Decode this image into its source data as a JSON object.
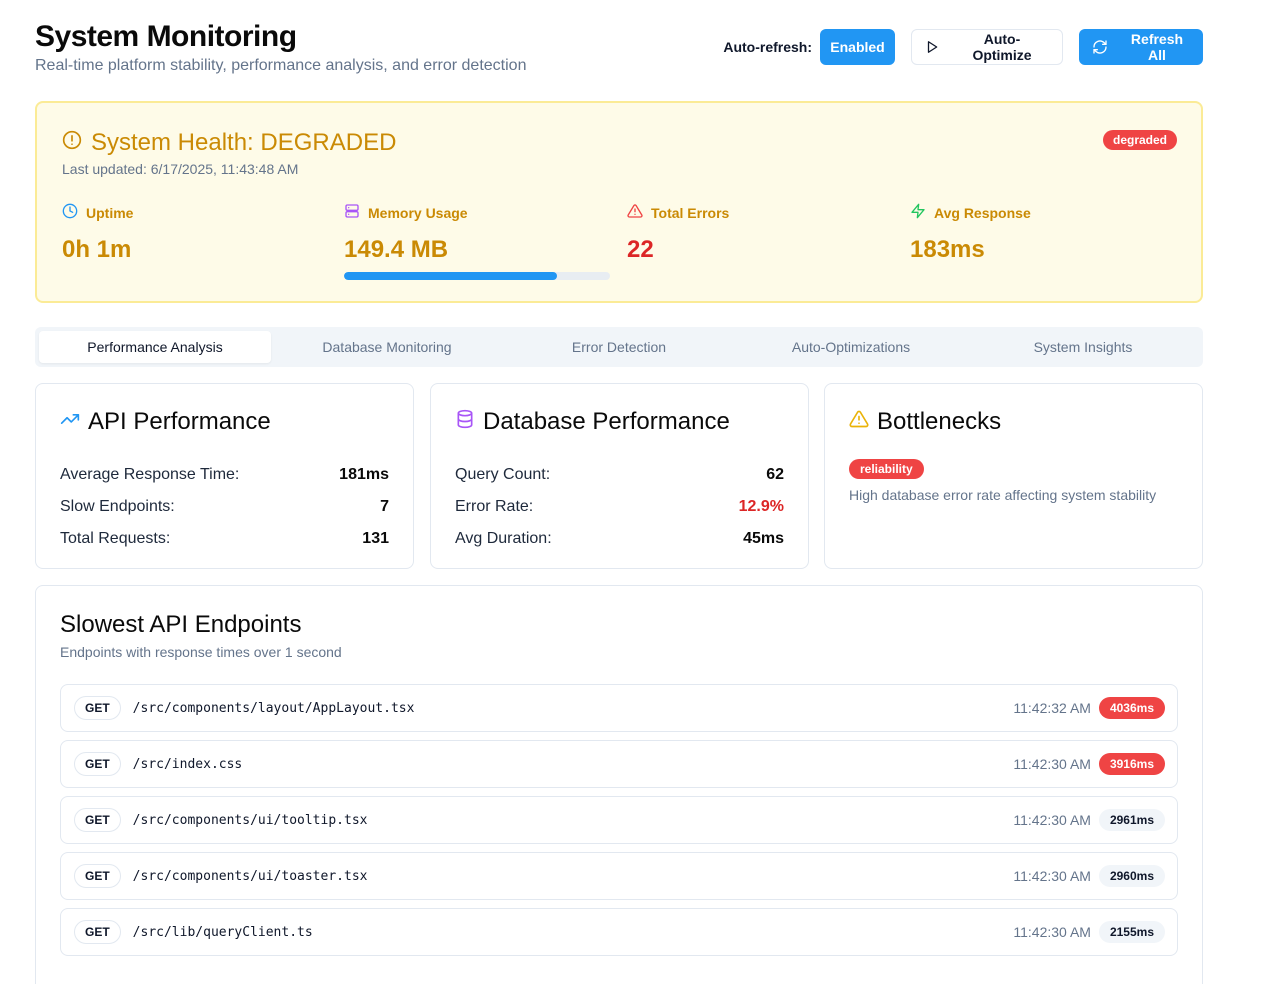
{
  "header": {
    "title": "System Monitoring",
    "subtitle": "Real-time platform stability, performance analysis, and error detection",
    "auto_refresh_label": "Auto-refresh:",
    "auto_refresh_state": "Enabled",
    "auto_optimize_label": "Auto-Optimize",
    "refresh_all_label": "Refresh All"
  },
  "health": {
    "title": "System Health: DEGRADED",
    "last_updated": "Last updated: 6/17/2025, 11:43:48 AM",
    "status_badge": "degraded",
    "metrics": {
      "uptime": {
        "label": "Uptime",
        "value": "0h 1m"
      },
      "memory": {
        "label": "Memory Usage",
        "value": "149.4 MB",
        "usage_fraction": 0.8
      },
      "errors": {
        "label": "Total Errors",
        "value": "22"
      },
      "response": {
        "label": "Avg Response",
        "value": "183ms"
      }
    }
  },
  "tabs": [
    {
      "label": "Performance Analysis",
      "active": true
    },
    {
      "label": "Database Monitoring",
      "active": false
    },
    {
      "label": "Error Detection",
      "active": false
    },
    {
      "label": "Auto-Optimizations",
      "active": false
    },
    {
      "label": "System Insights",
      "active": false
    }
  ],
  "api_performance": {
    "title": "API Performance",
    "rows": [
      {
        "label": "Average Response Time:",
        "value": "181ms"
      },
      {
        "label": "Slow Endpoints:",
        "value": "7"
      },
      {
        "label": "Total Requests:",
        "value": "131"
      }
    ]
  },
  "db_performance": {
    "title": "Database Performance",
    "rows": [
      {
        "label": "Query Count:",
        "value": "62"
      },
      {
        "label": "Error Rate:",
        "value": "12.9%"
      },
      {
        "label": "Avg Duration:",
        "value": "45ms"
      }
    ]
  },
  "bottlenecks": {
    "title": "Bottlenecks",
    "tag": "reliability",
    "description": "High database error rate affecting system stability"
  },
  "slow_endpoints": {
    "title": "Slowest API Endpoints",
    "subtitle": "Endpoints with response times over 1 second",
    "items": [
      {
        "method": "GET",
        "path": "/src/components/layout/AppLayout.tsx",
        "time": "11:42:32 AM",
        "duration": "4036ms",
        "severity": "high"
      },
      {
        "method": "GET",
        "path": "/src/index.css",
        "time": "11:42:30 AM",
        "duration": "3916ms",
        "severity": "high"
      },
      {
        "method": "GET",
        "path": "/src/components/ui/tooltip.tsx",
        "time": "11:42:30 AM",
        "duration": "2961ms",
        "severity": "normal"
      },
      {
        "method": "GET",
        "path": "/src/components/ui/toaster.tsx",
        "time": "11:42:30 AM",
        "duration": "2960ms",
        "severity": "normal"
      },
      {
        "method": "GET",
        "path": "/src/lib/queryClient.ts",
        "time": "11:42:30 AM",
        "duration": "2155ms",
        "severity": "normal"
      }
    ]
  },
  "colors": {
    "primary": "#2196f3",
    "warning": "#ca8a04",
    "danger": "#ef4444",
    "health_bg": "#fefbe8"
  }
}
